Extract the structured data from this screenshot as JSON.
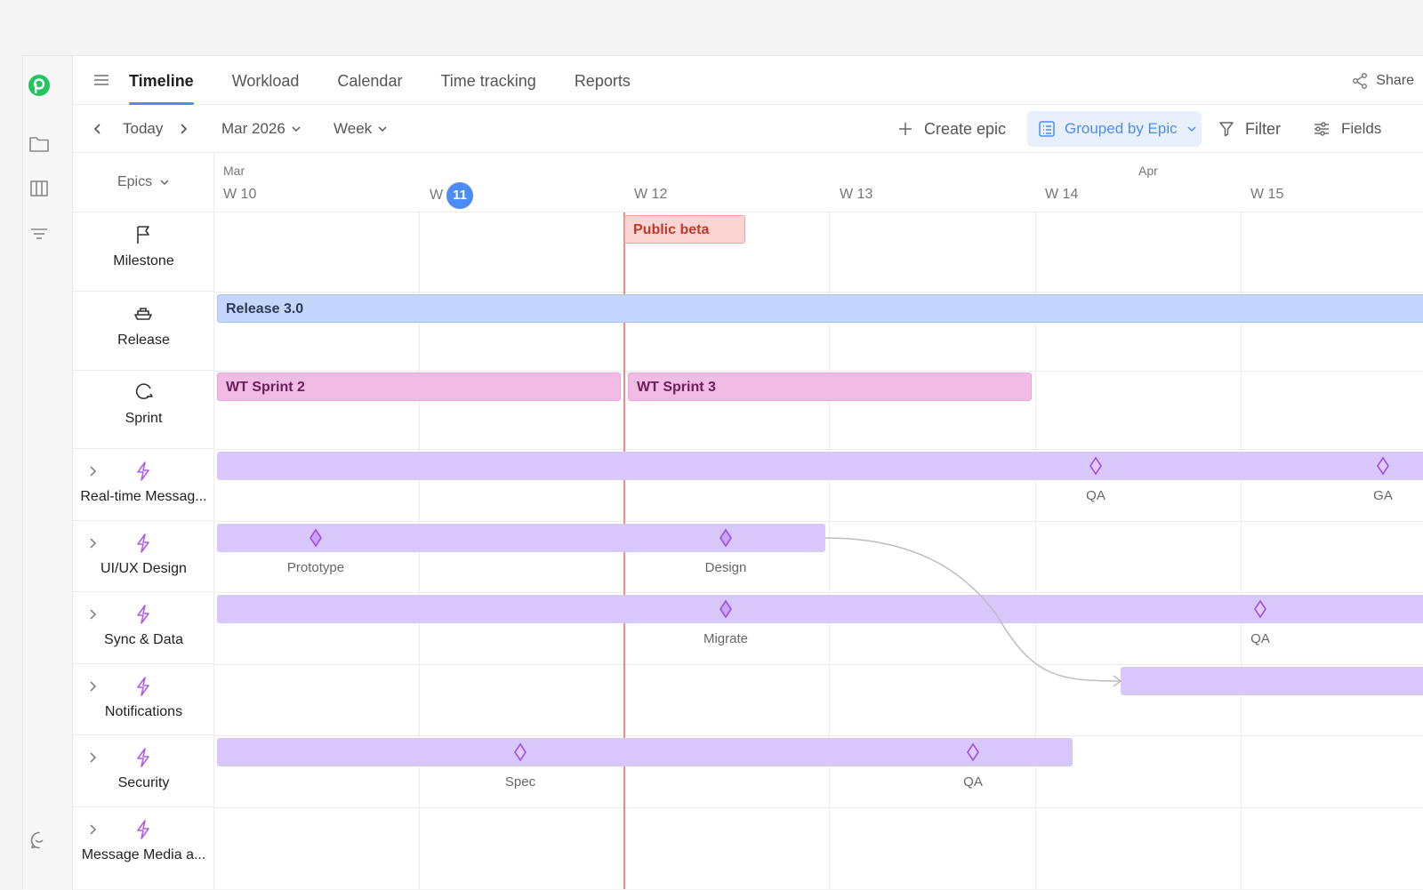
{
  "nav": {
    "tabs": [
      {
        "label": "Timeline",
        "active": true
      },
      {
        "label": "Workload"
      },
      {
        "label": "Calendar"
      },
      {
        "label": "Time tracking"
      },
      {
        "label": "Reports"
      }
    ],
    "share_label": "Share"
  },
  "toolbar": {
    "today_label": "Today",
    "month_value": "Mar 2026",
    "scale_value": "Week",
    "create_epic_label": "Create epic",
    "grouped_label": "Grouped by Epic",
    "filter_label": "Filter",
    "fields_label": "Fields"
  },
  "sidebar_header": {
    "label": "Epics"
  },
  "timeline": {
    "months": [
      {
        "label": "Mar",
        "x": 0
      },
      {
        "label": "Apr",
        "x": 0
      }
    ],
    "weeks": [
      "W 10",
      "W",
      "W 12",
      "W 13",
      "W 14",
      "W 15"
    ],
    "current_week_badge": "11"
  },
  "rows": [
    {
      "label": "Milestone",
      "type": "milestone"
    },
    {
      "label": "Release",
      "type": "release"
    },
    {
      "label": "Sprint",
      "type": "sprint"
    },
    {
      "label": "Real-time Messag...",
      "type": "epic"
    },
    {
      "label": "UI/UX Design",
      "type": "epic"
    },
    {
      "label": "Sync & Data",
      "type": "epic"
    },
    {
      "label": "Notifications",
      "type": "epic"
    },
    {
      "label": "Security",
      "type": "epic"
    },
    {
      "label": "Message Media a...",
      "type": "epic"
    }
  ],
  "bars": {
    "milestone": "Public beta",
    "release": "Release 3.0",
    "sprint_a": "WT Sprint 2",
    "sprint_b": "WT Sprint 3"
  },
  "milestone_labels": {
    "rt_qa": "QA",
    "rt_ga": "GA",
    "ux_prototype": "Prototype",
    "ux_design": "Design",
    "sync_migrate": "Migrate",
    "sync_qa": "QA",
    "sec_spec": "Spec",
    "sec_qa": "QA"
  },
  "colors": {
    "accent": "#4d8cf5",
    "milestone_bg": "#fdd4d4",
    "release_bg": "#c4d6fb",
    "sprint_bg": "#f2bbe6",
    "epic_bg": "#d7c7fb",
    "diamond": "#a64fe0",
    "today_line": "#f08a8a",
    "brand": "#22c55e"
  },
  "icons": {
    "brand": "brand-logo-icon",
    "folder": "folder-icon",
    "board": "board-icon",
    "filter_lines": "filter-lines-icon",
    "chat": "chat-icon"
  }
}
